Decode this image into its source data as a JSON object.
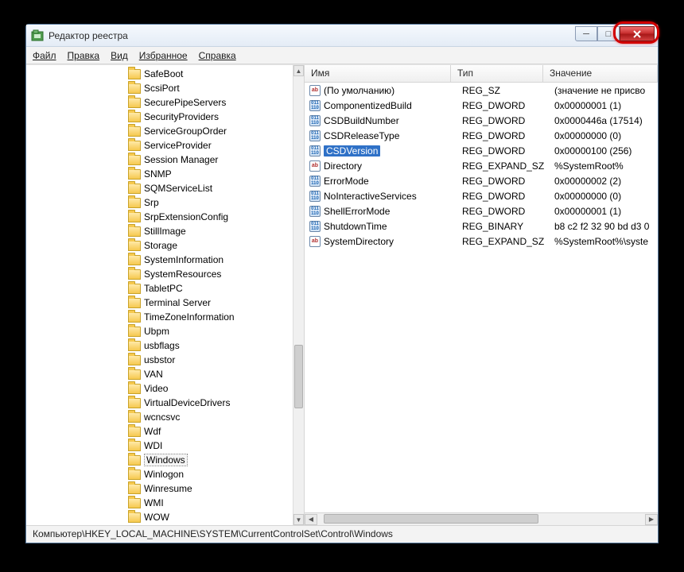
{
  "window": {
    "title": "Редактор реестра"
  },
  "menu": {
    "file": "Файл",
    "edit": "Правка",
    "view": "Вид",
    "favorites": "Избранное",
    "help": "Справка"
  },
  "tree": {
    "items": [
      {
        "label": "SafeBoot"
      },
      {
        "label": "ScsiPort"
      },
      {
        "label": "SecurePipeServers"
      },
      {
        "label": "SecurityProviders"
      },
      {
        "label": "ServiceGroupOrder"
      },
      {
        "label": "ServiceProvider"
      },
      {
        "label": "Session Manager"
      },
      {
        "label": "SNMP"
      },
      {
        "label": "SQMServiceList"
      },
      {
        "label": "Srp"
      },
      {
        "label": "SrpExtensionConfig"
      },
      {
        "label": "StillImage"
      },
      {
        "label": "Storage"
      },
      {
        "label": "SystemInformation"
      },
      {
        "label": "SystemResources"
      },
      {
        "label": "TabletPC"
      },
      {
        "label": "Terminal Server"
      },
      {
        "label": "TimeZoneInformation"
      },
      {
        "label": "Ubpm"
      },
      {
        "label": "usbflags"
      },
      {
        "label": "usbstor"
      },
      {
        "label": "VAN"
      },
      {
        "label": "Video"
      },
      {
        "label": "VirtualDeviceDrivers"
      },
      {
        "label": "wcncsvc"
      },
      {
        "label": "Wdf"
      },
      {
        "label": "WDI"
      },
      {
        "label": "Windows",
        "selected": true
      },
      {
        "label": "Winlogon"
      },
      {
        "label": "Winresume"
      },
      {
        "label": "WMI"
      },
      {
        "label": "WOW"
      }
    ]
  },
  "list": {
    "headers": {
      "name": "Имя",
      "type": "Тип",
      "value": "Значение"
    },
    "rows": [
      {
        "icon": "ab",
        "name": "(По умолчанию)",
        "type": "REG_SZ",
        "value": "(значение не присво"
      },
      {
        "icon": "num",
        "name": "ComponentizedBuild",
        "type": "REG_DWORD",
        "value": "0x00000001 (1)"
      },
      {
        "icon": "num",
        "name": "CSDBuildNumber",
        "type": "REG_DWORD",
        "value": "0x0000446a (17514)"
      },
      {
        "icon": "num",
        "name": "CSDReleaseType",
        "type": "REG_DWORD",
        "value": "0x00000000 (0)"
      },
      {
        "icon": "num",
        "name": "CSDVersion",
        "type": "REG_DWORD",
        "value": "0x00000100 (256)",
        "selected": true
      },
      {
        "icon": "ab",
        "name": "Directory",
        "type": "REG_EXPAND_SZ",
        "value": "%SystemRoot%"
      },
      {
        "icon": "num",
        "name": "ErrorMode",
        "type": "REG_DWORD",
        "value": "0x00000002 (2)"
      },
      {
        "icon": "num",
        "name": "NoInteractiveServices",
        "type": "REG_DWORD",
        "value": "0x00000000 (0)"
      },
      {
        "icon": "num",
        "name": "ShellErrorMode",
        "type": "REG_DWORD",
        "value": "0x00000001 (1)"
      },
      {
        "icon": "num",
        "name": "ShutdownTime",
        "type": "REG_BINARY",
        "value": "b8 c2 f2 32 90 bd d3 0"
      },
      {
        "icon": "ab",
        "name": "SystemDirectory",
        "type": "REG_EXPAND_SZ",
        "value": "%SystemRoot%\\syste"
      }
    ]
  },
  "statusbar": {
    "path": "Компьютер\\HKEY_LOCAL_MACHINE\\SYSTEM\\CurrentControlSet\\Control\\Windows"
  },
  "icons": {
    "ab": "ab",
    "num": "011 110"
  }
}
